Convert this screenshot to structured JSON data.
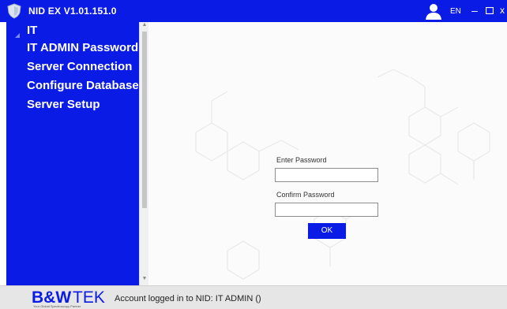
{
  "window": {
    "title": "NID EX V1.01.151.0",
    "language": "EN",
    "minimize_glyph": "–",
    "close_glyph": "x"
  },
  "sidebar": {
    "items": [
      {
        "label": "IT"
      },
      {
        "label": "IT ADMIN Password"
      },
      {
        "label": "Server Connection"
      },
      {
        "label": "Configure Database"
      },
      {
        "label": "Server Setup"
      }
    ]
  },
  "form": {
    "enter_password_label": "Enter Password",
    "enter_password_value": "",
    "confirm_password_label": "Confirm Password",
    "confirm_password_value": "",
    "ok_label": "OK"
  },
  "status": {
    "logo_text": "B&WTEK",
    "logo_tagline": "Your Global Spectroscopy Partner",
    "text": "Account logged in to NID: IT ADMIN ()"
  },
  "colors": {
    "brand_blue": "#0b1be6",
    "status_bar": "#e6e6e6"
  }
}
